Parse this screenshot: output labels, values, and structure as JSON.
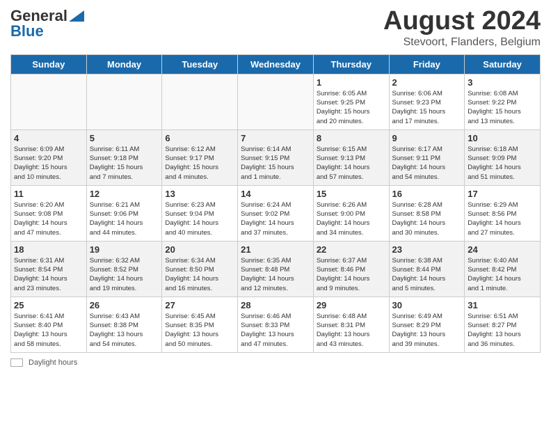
{
  "header": {
    "logo_general": "General",
    "logo_blue": "Blue",
    "month_title": "August 2024",
    "location": "Stevoort, Flanders, Belgium"
  },
  "days_of_week": [
    "Sunday",
    "Monday",
    "Tuesday",
    "Wednesday",
    "Thursday",
    "Friday",
    "Saturday"
  ],
  "footer": {
    "daylight_label": "Daylight hours"
  },
  "weeks": [
    [
      {
        "day": "",
        "info": ""
      },
      {
        "day": "",
        "info": ""
      },
      {
        "day": "",
        "info": ""
      },
      {
        "day": "",
        "info": ""
      },
      {
        "day": "1",
        "info": "Sunrise: 6:05 AM\nSunset: 9:25 PM\nDaylight: 15 hours\nand 20 minutes."
      },
      {
        "day": "2",
        "info": "Sunrise: 6:06 AM\nSunset: 9:23 PM\nDaylight: 15 hours\nand 17 minutes."
      },
      {
        "day": "3",
        "info": "Sunrise: 6:08 AM\nSunset: 9:22 PM\nDaylight: 15 hours\nand 13 minutes."
      }
    ],
    [
      {
        "day": "4",
        "info": "Sunrise: 6:09 AM\nSunset: 9:20 PM\nDaylight: 15 hours\nand 10 minutes."
      },
      {
        "day": "5",
        "info": "Sunrise: 6:11 AM\nSunset: 9:18 PM\nDaylight: 15 hours\nand 7 minutes."
      },
      {
        "day": "6",
        "info": "Sunrise: 6:12 AM\nSunset: 9:17 PM\nDaylight: 15 hours\nand 4 minutes."
      },
      {
        "day": "7",
        "info": "Sunrise: 6:14 AM\nSunset: 9:15 PM\nDaylight: 15 hours\nand 1 minute."
      },
      {
        "day": "8",
        "info": "Sunrise: 6:15 AM\nSunset: 9:13 PM\nDaylight: 14 hours\nand 57 minutes."
      },
      {
        "day": "9",
        "info": "Sunrise: 6:17 AM\nSunset: 9:11 PM\nDaylight: 14 hours\nand 54 minutes."
      },
      {
        "day": "10",
        "info": "Sunrise: 6:18 AM\nSunset: 9:09 PM\nDaylight: 14 hours\nand 51 minutes."
      }
    ],
    [
      {
        "day": "11",
        "info": "Sunrise: 6:20 AM\nSunset: 9:08 PM\nDaylight: 14 hours\nand 47 minutes."
      },
      {
        "day": "12",
        "info": "Sunrise: 6:21 AM\nSunset: 9:06 PM\nDaylight: 14 hours\nand 44 minutes."
      },
      {
        "day": "13",
        "info": "Sunrise: 6:23 AM\nSunset: 9:04 PM\nDaylight: 14 hours\nand 40 minutes."
      },
      {
        "day": "14",
        "info": "Sunrise: 6:24 AM\nSunset: 9:02 PM\nDaylight: 14 hours\nand 37 minutes."
      },
      {
        "day": "15",
        "info": "Sunrise: 6:26 AM\nSunset: 9:00 PM\nDaylight: 14 hours\nand 34 minutes."
      },
      {
        "day": "16",
        "info": "Sunrise: 6:28 AM\nSunset: 8:58 PM\nDaylight: 14 hours\nand 30 minutes."
      },
      {
        "day": "17",
        "info": "Sunrise: 6:29 AM\nSunset: 8:56 PM\nDaylight: 14 hours\nand 27 minutes."
      }
    ],
    [
      {
        "day": "18",
        "info": "Sunrise: 6:31 AM\nSunset: 8:54 PM\nDaylight: 14 hours\nand 23 minutes."
      },
      {
        "day": "19",
        "info": "Sunrise: 6:32 AM\nSunset: 8:52 PM\nDaylight: 14 hours\nand 19 minutes."
      },
      {
        "day": "20",
        "info": "Sunrise: 6:34 AM\nSunset: 8:50 PM\nDaylight: 14 hours\nand 16 minutes."
      },
      {
        "day": "21",
        "info": "Sunrise: 6:35 AM\nSunset: 8:48 PM\nDaylight: 14 hours\nand 12 minutes."
      },
      {
        "day": "22",
        "info": "Sunrise: 6:37 AM\nSunset: 8:46 PM\nDaylight: 14 hours\nand 9 minutes."
      },
      {
        "day": "23",
        "info": "Sunrise: 6:38 AM\nSunset: 8:44 PM\nDaylight: 14 hours\nand 5 minutes."
      },
      {
        "day": "24",
        "info": "Sunrise: 6:40 AM\nSunset: 8:42 PM\nDaylight: 14 hours\nand 1 minute."
      }
    ],
    [
      {
        "day": "25",
        "info": "Sunrise: 6:41 AM\nSunset: 8:40 PM\nDaylight: 13 hours\nand 58 minutes."
      },
      {
        "day": "26",
        "info": "Sunrise: 6:43 AM\nSunset: 8:38 PM\nDaylight: 13 hours\nand 54 minutes."
      },
      {
        "day": "27",
        "info": "Sunrise: 6:45 AM\nSunset: 8:35 PM\nDaylight: 13 hours\nand 50 minutes."
      },
      {
        "day": "28",
        "info": "Sunrise: 6:46 AM\nSunset: 8:33 PM\nDaylight: 13 hours\nand 47 minutes."
      },
      {
        "day": "29",
        "info": "Sunrise: 6:48 AM\nSunset: 8:31 PM\nDaylight: 13 hours\nand 43 minutes."
      },
      {
        "day": "30",
        "info": "Sunrise: 6:49 AM\nSunset: 8:29 PM\nDaylight: 13 hours\nand 39 minutes."
      },
      {
        "day": "31",
        "info": "Sunrise: 6:51 AM\nSunset: 8:27 PM\nDaylight: 13 hours\nand 36 minutes."
      }
    ]
  ]
}
